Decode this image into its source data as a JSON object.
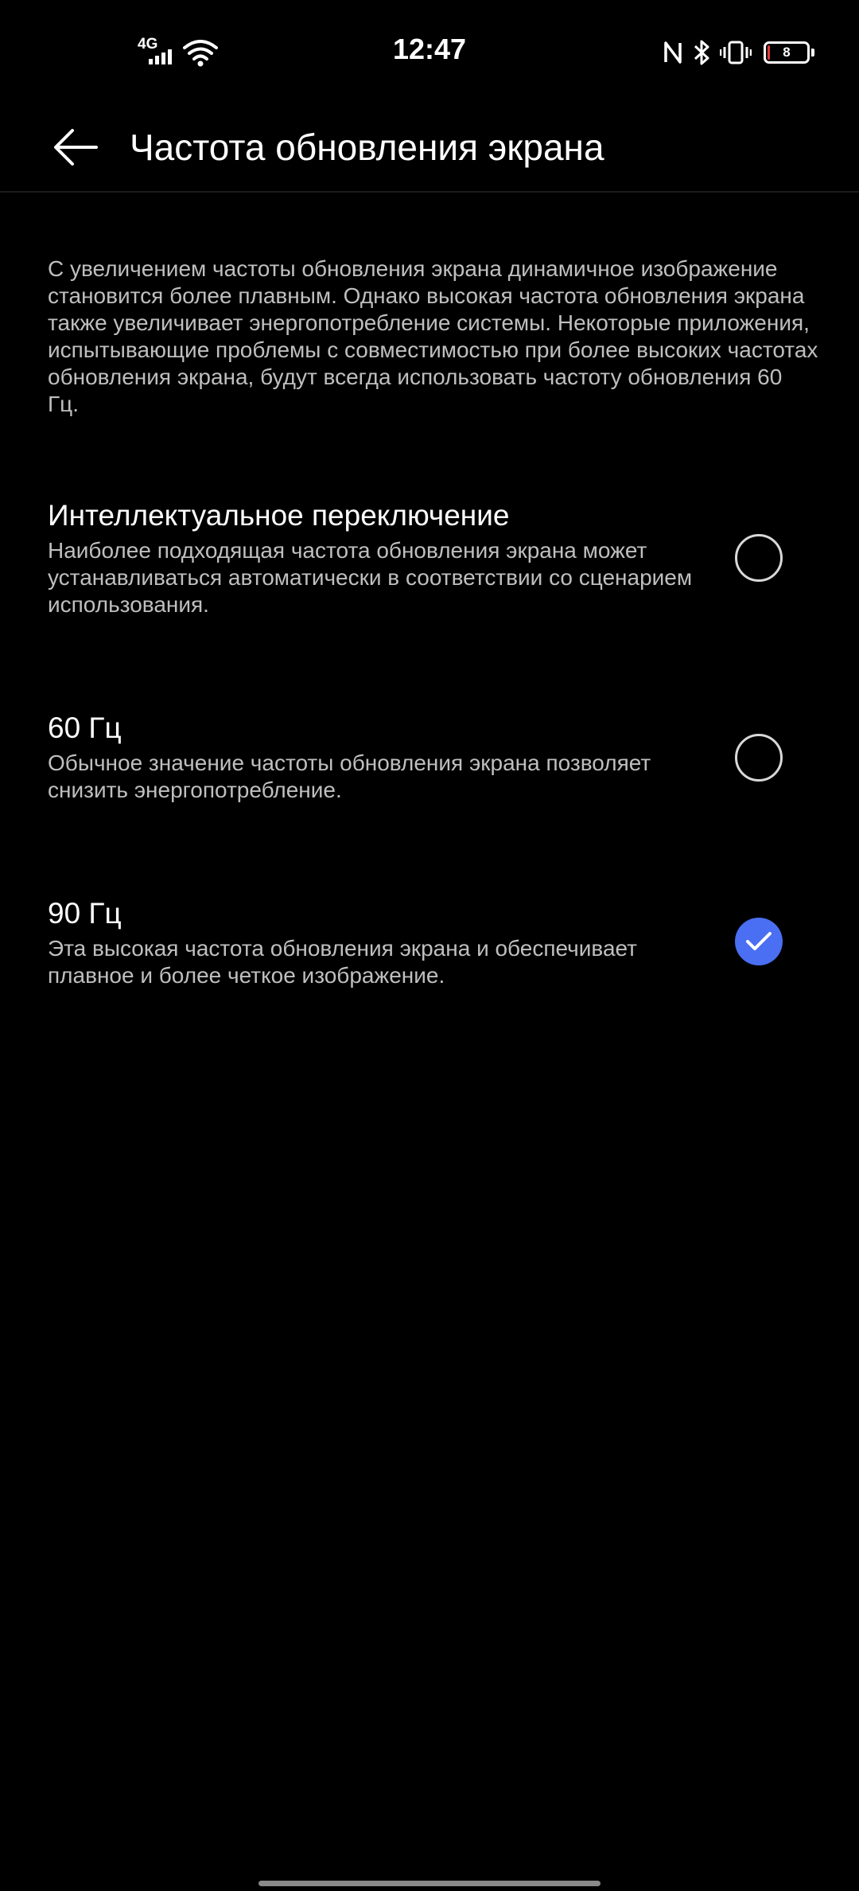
{
  "status_bar": {
    "time": "12:47",
    "network_type": "4G",
    "battery_level": "8",
    "icons": [
      "signal-icon",
      "wifi-icon",
      "nfc-icon",
      "bluetooth-icon",
      "vibrate-icon",
      "battery-icon"
    ],
    "battery_low_color": "#e53935"
  },
  "header": {
    "title": "Частота обновления экрана",
    "back_icon": "arrow-left-icon"
  },
  "description": "С увеличением частоты обновления экрана динамичное изображение становится более плавным. Однако высокая частота обновления экрана также увеличивает энергопотребление системы. Некоторые приложения, испытывающие проблемы с совместимостью при более высоких частотах обновления экрана, будут всегда использовать частоту обновления 60 Гц.",
  "options": [
    {
      "title": "Интеллектуальное переключение",
      "description": "Наиболее подходящая частота обновления экрана может устанавливаться автоматически в соответствии со сценарием использования.",
      "selected": false
    },
    {
      "title": "60 Гц",
      "description": "Обычное значение частоты обновления экрана позволяет снизить энергопотребление.",
      "selected": false
    },
    {
      "title": "90 Гц",
      "description": "Эта высокая частота обновления экрана и обеспечивает плавное и более четкое изображение.",
      "selected": true
    }
  ],
  "colors": {
    "background": "#000000",
    "accent": "#4a6ff2",
    "text_primary": "#ffffff",
    "text_secondary": "#bfbfbf"
  }
}
